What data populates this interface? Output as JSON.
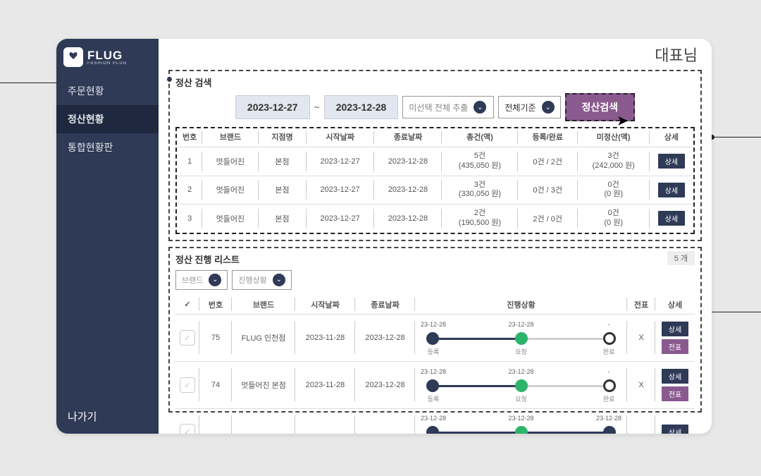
{
  "header": {
    "user_label": "대표님"
  },
  "logo": {
    "name": "FLUG",
    "sub": "FASHION PLUG"
  },
  "sidebar": {
    "items": [
      {
        "label": "주문현황"
      },
      {
        "label": "정산현황"
      },
      {
        "label": "통합현황판"
      }
    ],
    "exit": "나가기"
  },
  "search": {
    "title": "정산 검색",
    "date_from": "2023-12-27",
    "date_to": "2023-12-28",
    "tilde": "~",
    "filter1_placeholder": "미선택 전체 추출",
    "filter2": "전체기준",
    "button": "정산검색"
  },
  "table1": {
    "headers": {
      "no": "번호",
      "brand": "브랜드",
      "branch": "지점명",
      "start": "시작날짜",
      "end": "종료날짜",
      "total": "총건(액)",
      "reg": "등록/완료",
      "unsettled": "미정산(액)",
      "detail": "상세"
    },
    "detail_label": "상세",
    "rows": [
      {
        "no": "1",
        "brand": "멋들어진",
        "branch": "본점",
        "start": "2023-12-27",
        "end": "2023-12-28",
        "total_l1": "5건",
        "total_l2": "(435,050 원)",
        "reg": "0건 / 2건",
        "un_l1": "3건",
        "un_l2": "(242,000 원)"
      },
      {
        "no": "2",
        "brand": "멋들어진",
        "branch": "본점",
        "start": "2023-12-27",
        "end": "2023-12-28",
        "total_l1": "3건",
        "total_l2": "(330,050 원)",
        "reg": "0건 / 3건",
        "un_l1": "0건",
        "un_l2": "(0 원)"
      },
      {
        "no": "3",
        "brand": "멋들어진",
        "branch": "본점",
        "start": "2023-12-27",
        "end": "2023-12-28",
        "total_l1": "2건",
        "total_l2": "(190,500 원)",
        "reg": "2건 / 0건",
        "un_l1": "0건",
        "un_l2": "(0 원)"
      }
    ]
  },
  "list": {
    "title": "정산 진행 리스트",
    "count": "5 개",
    "filter_brand": "브랜드",
    "filter_status": "진행상황",
    "headers": {
      "check": "✓",
      "no": "번호",
      "brand": "브랜드",
      "start": "시작날짜",
      "end": "종료날짜",
      "progress": "진행상황",
      "voucher": "전표",
      "detail": "상세"
    },
    "progress_labels": {
      "reg": "등록",
      "req": "요청",
      "done": "완료"
    },
    "detail_label": "상세",
    "voucher_label": "전표",
    "rows": [
      {
        "no": "75",
        "brand": "FLUG 인천점",
        "start": "2023-11-28",
        "end": "2023-12-28",
        "pd1": "23-12-28",
        "pd2": "23-12-28",
        "pd3": "-",
        "seg1_color": "#2e3a56",
        "seg2_color": "#cfcfcf",
        "s1": "filled-dark",
        "s2": "filled-green",
        "s3": "open",
        "voucher": "X",
        "show_voucher_btn": true
      },
      {
        "no": "74",
        "brand": "멋들어진 본점",
        "start": "2023-11-28",
        "end": "2023-12-28",
        "pd1": "23-12-28",
        "pd2": "23-12-28",
        "pd3": "-",
        "seg1_color": "#2e3a56",
        "seg2_color": "#cfcfcf",
        "s1": "filled-dark",
        "s2": "filled-green",
        "s3": "open",
        "voucher": "X",
        "show_voucher_btn": true
      },
      {
        "no": "",
        "brand": "",
        "start": "",
        "end": "",
        "pd1": "23-12-28",
        "pd2": "23-12-28",
        "pd3": "23-12-28",
        "seg1_color": "#2e3a56",
        "seg2_color": "#2e3a56",
        "s1": "filled-dark",
        "s2": "filled-green",
        "s3": "filled-dark",
        "voucher": "",
        "show_voucher_btn": false
      }
    ]
  }
}
